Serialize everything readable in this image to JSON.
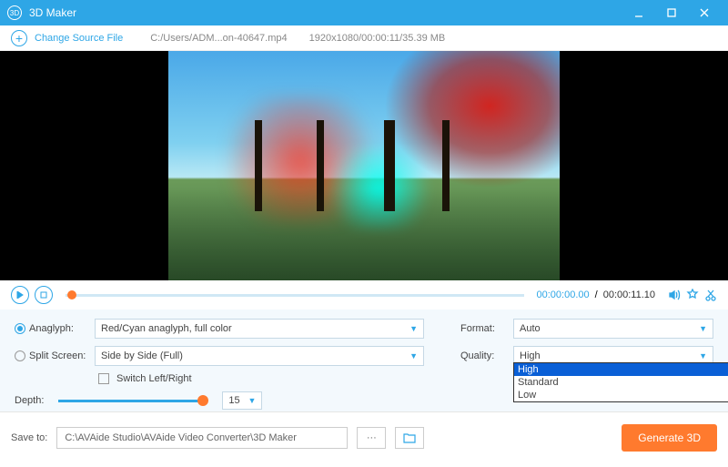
{
  "titlebar": {
    "app_name": "3D Maker"
  },
  "source": {
    "change_label": "Change Source File",
    "file_path": "C:/Users/ADM...on-40647.mp4",
    "file_info": "1920x1080/00:00:11/35.39 MB"
  },
  "player": {
    "current_time": "00:00:00.00",
    "duration": "00:00:11.10",
    "separator": "/"
  },
  "settings": {
    "anaglyph_label": "Anaglyph:",
    "anaglyph_value": "Red/Cyan anaglyph, full color",
    "split_label": "Split Screen:",
    "split_value": "Side by Side (Full)",
    "switch_label": "Switch Left/Right",
    "depth_label": "Depth:",
    "depth_value": "15",
    "format_label": "Format:",
    "format_value": "Auto",
    "quality_label": "Quality:",
    "quality_value": "High",
    "quality_options": [
      "High",
      "Standard",
      "Low"
    ]
  },
  "bottom": {
    "save_label": "Save to:",
    "save_path": "C:\\AVAide Studio\\AVAide Video Converter\\3D Maker",
    "browse_dots": "···",
    "generate_label": "Generate 3D"
  }
}
